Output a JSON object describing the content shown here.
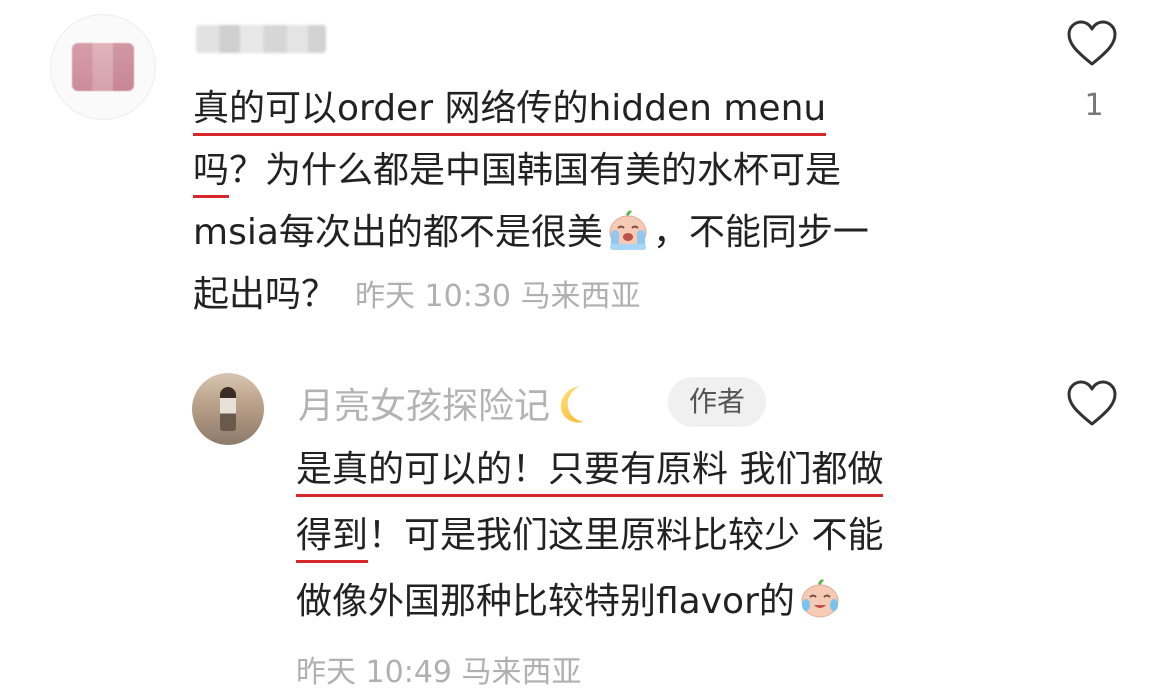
{
  "comment": {
    "line1": "真的可以order 网络传的hidden menu",
    "line2_a": "吗",
    "line2_b": "？为什么都是中国韩国有美的水杯可是",
    "line3_a": "msia每次出的都不是很美",
    "line3_b": "，不能同步一",
    "line4": "起出吗？",
    "time": "昨天 10:30",
    "location": "马来西亚",
    "like_count": "1"
  },
  "reply": {
    "author": "月亮女孩探险记",
    "author_emoji": "crescent-moon-icon",
    "badge": "作者",
    "line1": "是真的可以的！只要有原料 我们都做",
    "line2_a": "得到",
    "line2_b": "！可是我们这里原料比较少 不能",
    "line3": "做像外国那种比较特别flavor的",
    "time": "昨天 10:49",
    "location": "马来西亚"
  },
  "colors": {
    "underline": "#d7262c",
    "meta_gray": "#b0b0b0",
    "badge_bg": "#f0f0f0"
  },
  "icons": [
    "heart-icon",
    "crying-emoji-icon",
    "crescent-moon-icon"
  ]
}
